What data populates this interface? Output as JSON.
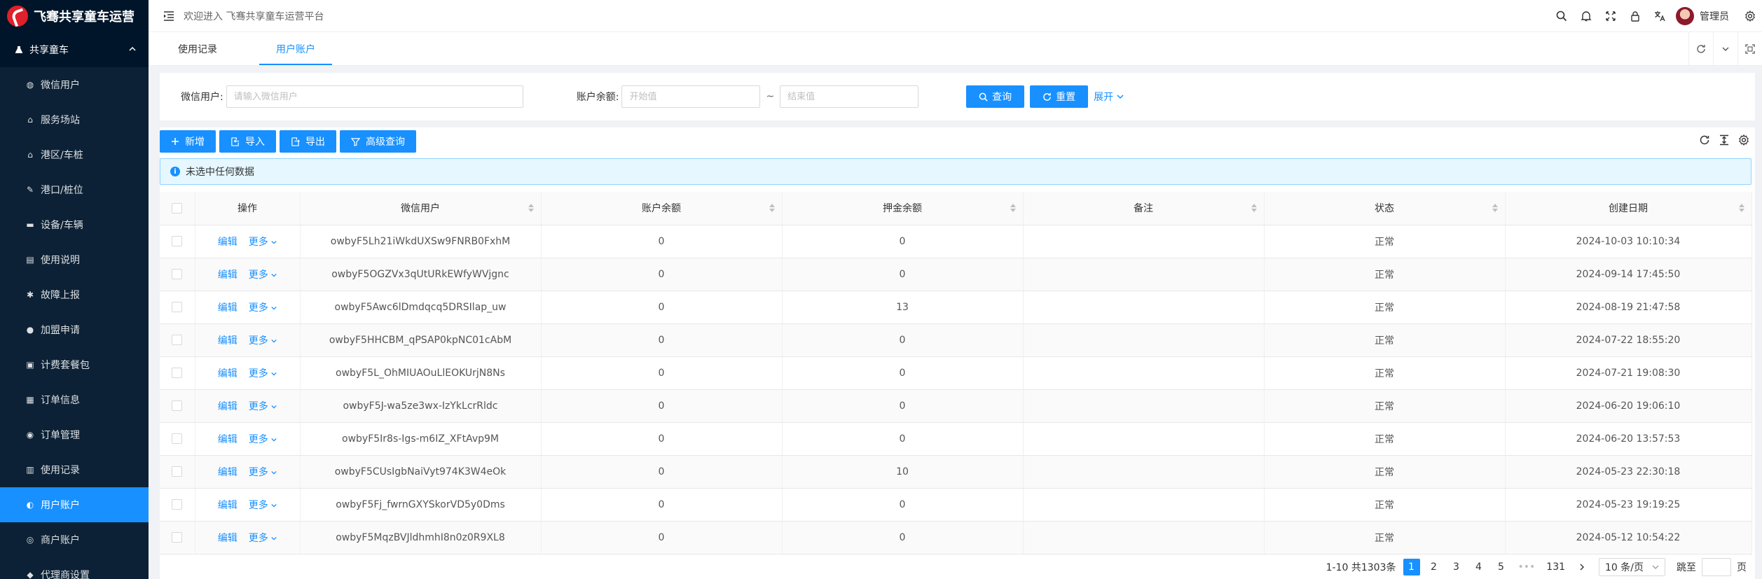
{
  "app": {
    "logo_text": "飞骞共享童车运营"
  },
  "sidebar": {
    "group_label": "共享童车",
    "items": [
      {
        "label": "微信用户",
        "icon": "user-icon"
      },
      {
        "label": "服务场站",
        "icon": "bank-icon"
      },
      {
        "label": "港区/车桩",
        "icon": "bank-icon"
      },
      {
        "label": "港口/桩位",
        "icon": "tool-icon"
      },
      {
        "label": "设备/车辆",
        "icon": "car-icon"
      },
      {
        "label": "使用说明",
        "icon": "file-icon"
      },
      {
        "label": "故障上报",
        "icon": "bug-icon"
      },
      {
        "label": "加盟申请",
        "icon": "dollar-icon"
      },
      {
        "label": "计费套餐包",
        "icon": "package-icon"
      },
      {
        "label": "订单信息",
        "icon": "order-icon"
      },
      {
        "label": "订单管理",
        "icon": "order-manage-icon"
      },
      {
        "label": "使用记录",
        "icon": "record-icon"
      },
      {
        "label": "用户账户",
        "icon": "account-icon"
      },
      {
        "label": "商户账户",
        "icon": "merchant-icon"
      },
      {
        "label": "代理商设置",
        "icon": "android-icon"
      }
    ],
    "active_index": 12
  },
  "header": {
    "welcome": "欢迎进入 飞骞共享童车运营平台",
    "username": "管理员"
  },
  "tabs": [
    {
      "label": "使用记录",
      "active": false
    },
    {
      "label": "用户账户",
      "active": true
    }
  ],
  "search": {
    "wechat_label": "微信用户:",
    "wechat_placeholder": "请输入微信用户",
    "balance_label": "账户余额:",
    "balance_start_placeholder": "开始值",
    "balance_end_placeholder": "结束值",
    "tilde": "~",
    "query_label": "查询",
    "reset_label": "重置",
    "expand_label": "展开"
  },
  "toolbar": {
    "add_label": "新增",
    "import_label": "导入",
    "export_label": "导出",
    "advanced_label": "高级查询"
  },
  "alert": {
    "text": "未选中任何数据"
  },
  "table": {
    "columns": [
      "操作",
      "微信用户",
      "账户余额",
      "押金余额",
      "备注",
      "状态",
      "创建日期"
    ],
    "edit_label": "编辑",
    "more_label": "更多",
    "rows": [
      {
        "user": "owbyF5Lh21iWkdUXSw9FNRB0FxhM",
        "balance": "0",
        "deposit": "0",
        "note": "",
        "status": "正常",
        "date": "2024-10-03 10:10:34"
      },
      {
        "user": "owbyF5OGZVx3qUtURkEWfyWVjgnc",
        "balance": "0",
        "deposit": "0",
        "note": "",
        "status": "正常",
        "date": "2024-09-14 17:45:50"
      },
      {
        "user": "owbyF5Awc6lDmdqcq5DRSIlap_uw",
        "balance": "0",
        "deposit": "13",
        "note": "",
        "status": "正常",
        "date": "2024-08-19 21:47:58"
      },
      {
        "user": "owbyF5HHCBM_qPSAP0kpNC01cAbM",
        "balance": "0",
        "deposit": "0",
        "note": "",
        "status": "正常",
        "date": "2024-07-22 18:55:20"
      },
      {
        "user": "owbyF5L_OhMIUAOuLlEOKUrjN8Ns",
        "balance": "0",
        "deposit": "0",
        "note": "",
        "status": "正常",
        "date": "2024-07-21 19:08:30"
      },
      {
        "user": "owbyF5J-wa5ze3wx-IzYkLcrRldc",
        "balance": "0",
        "deposit": "0",
        "note": "",
        "status": "正常",
        "date": "2024-06-20 19:06:10"
      },
      {
        "user": "owbyF5Ir8s-Igs-m6IZ_XFtAvp9M",
        "balance": "0",
        "deposit": "0",
        "note": "",
        "status": "正常",
        "date": "2024-06-20 13:57:53"
      },
      {
        "user": "owbyF5CUsIgbNaiVyt974K3W4eOk",
        "balance": "0",
        "deposit": "10",
        "note": "",
        "status": "正常",
        "date": "2024-05-23 22:30:18"
      },
      {
        "user": "owbyF5Fj_fwrnGXYSkorVD5y0Dms",
        "balance": "0",
        "deposit": "0",
        "note": "",
        "status": "正常",
        "date": "2024-05-23 19:19:25"
      },
      {
        "user": "owbyF5MqzBVJldhmhI8n0z0R9XL8",
        "balance": "0",
        "deposit": "0",
        "note": "",
        "status": "正常",
        "date": "2024-05-12 10:54:22"
      }
    ]
  },
  "pagination": {
    "summary": "1-10 共1303条",
    "pages": [
      "1",
      "2",
      "3",
      "4",
      "5"
    ],
    "ellipsis": "•••",
    "last_page": "131",
    "page_size": "10 条/页",
    "jump_label": "跳至",
    "page_suffix": "页"
  },
  "colors": {
    "primary": "#1890ff",
    "sidebar_bg": "#001529"
  }
}
